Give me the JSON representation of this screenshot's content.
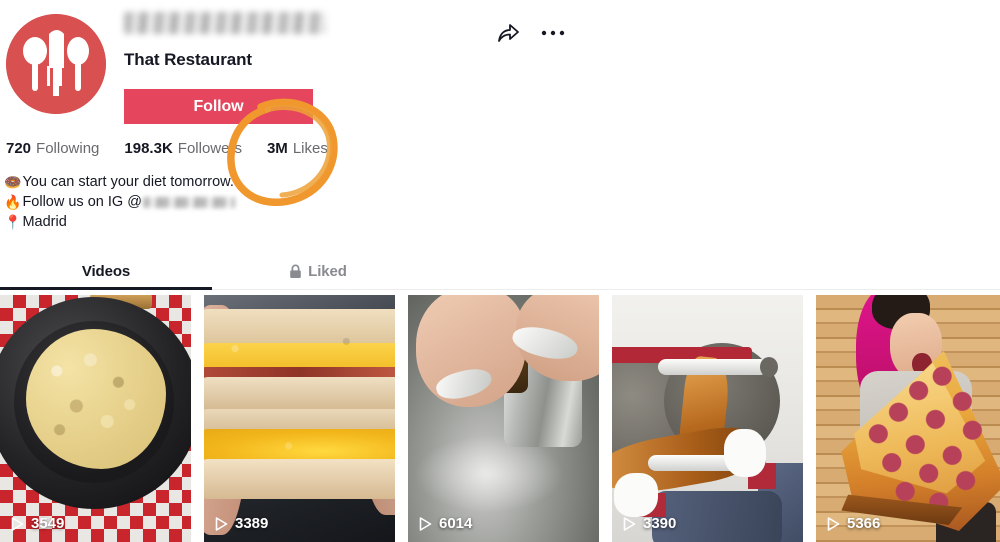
{
  "profile": {
    "username_redacted": true,
    "display_name": "That Restaurant",
    "follow_label": "Follow",
    "avatar_icon": "cutlery-logo-icon",
    "avatar_color": "#d8504f",
    "follow_color": "#e5465d"
  },
  "header_actions": {
    "share_icon": "share-arrow-icon",
    "more_icon": "more-dots-icon"
  },
  "stats": [
    {
      "key": "following",
      "value": "720",
      "label": "Following"
    },
    {
      "key": "followers",
      "value": "198.3K",
      "label": "Followers"
    },
    {
      "key": "likes",
      "value": "3M",
      "label": "Likes"
    }
  ],
  "annotation": {
    "shape": "hand-drawn-circle",
    "color": "#f0982d",
    "targets": "likes-stat"
  },
  "bio": {
    "line1_emoji": "🍩",
    "line1_text": "You can start your diet tomorrow.",
    "line2_emoji": "🔥",
    "line2_text": "Follow us on IG @",
    "line2_handle_redacted": true,
    "line3_emoji": "📍",
    "line3_text": "Madrid"
  },
  "tabs": [
    {
      "key": "videos",
      "label": "Videos",
      "active": true,
      "icon": null
    },
    {
      "key": "liked",
      "label": "Liked",
      "active": false,
      "icon": "lock-icon"
    }
  ],
  "videos": [
    {
      "views": "3549",
      "alt": "mac-and-cheese-on-black-plate"
    },
    {
      "views": "3389",
      "alt": "breakfast-sandwich-egg-bacon-cheese"
    },
    {
      "views": "6014",
      "alt": "hands-opening-metal-container"
    },
    {
      "views": "3390",
      "alt": "caramel-pulling-machine-gloved-hands"
    },
    {
      "views": "5366",
      "alt": "woman-with-giant-pepperoni-pizza-slice"
    }
  ]
}
